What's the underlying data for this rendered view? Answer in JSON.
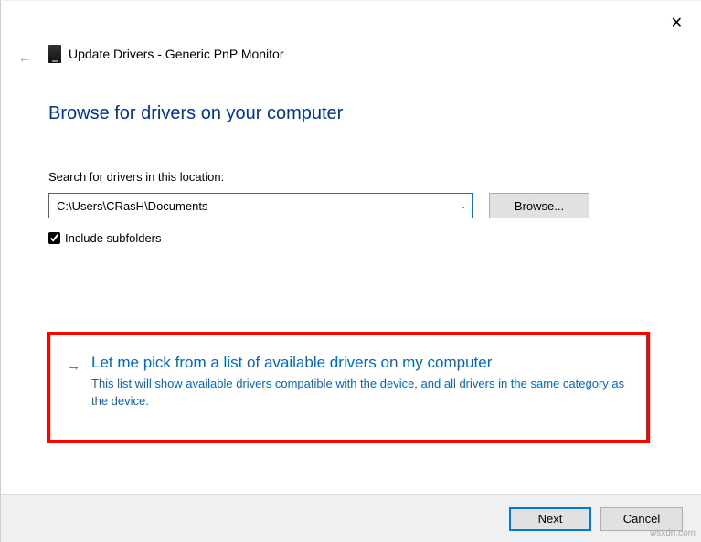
{
  "header": {
    "title": "Update Drivers - Generic PnP Monitor"
  },
  "main": {
    "title": "Browse for drivers on your computer",
    "search_label": "Search for drivers in this location:",
    "path_value": "C:\\Users\\CRasH\\Documents",
    "browse_label": "Browse...",
    "include_subfolders_label": "Include subfolders",
    "include_subfolders_checked": true
  },
  "option": {
    "title": "Let me pick from a list of available drivers on my computer",
    "description": "This list will show available drivers compatible with the device, and all drivers in the same category as the device."
  },
  "footer": {
    "next_label": "Next",
    "cancel_label": "Cancel"
  },
  "watermark": "wsxdn.com"
}
